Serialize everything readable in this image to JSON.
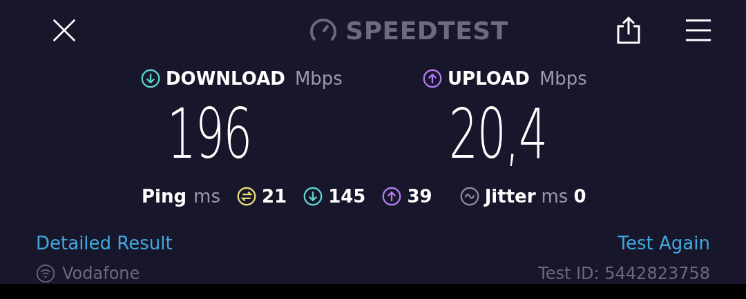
{
  "header": {
    "title": "SPEEDTEST"
  },
  "results": [
    {
      "kind": "download",
      "label": "DOWNLOAD",
      "unit": "Mbps",
      "value": "196"
    },
    {
      "kind": "upload",
      "label": "UPLOAD",
      "unit": "Mbps",
      "value": "20,4"
    }
  ],
  "ping_row": {
    "ping_label": "Ping",
    "ping_unit": "ms",
    "metrics": [
      {
        "kind": "ping",
        "value": "21"
      },
      {
        "kind": "download",
        "value": "145"
      },
      {
        "kind": "upload",
        "value": "39"
      }
    ],
    "jitter_label": "Jitter",
    "jitter_unit": "ms",
    "jitter_value": "0"
  },
  "links": [
    "Detailed Result",
    "Test Again"
  ],
  "footer": {
    "provider": "Vodafone",
    "test_id": "Test ID: 5442823758"
  }
}
